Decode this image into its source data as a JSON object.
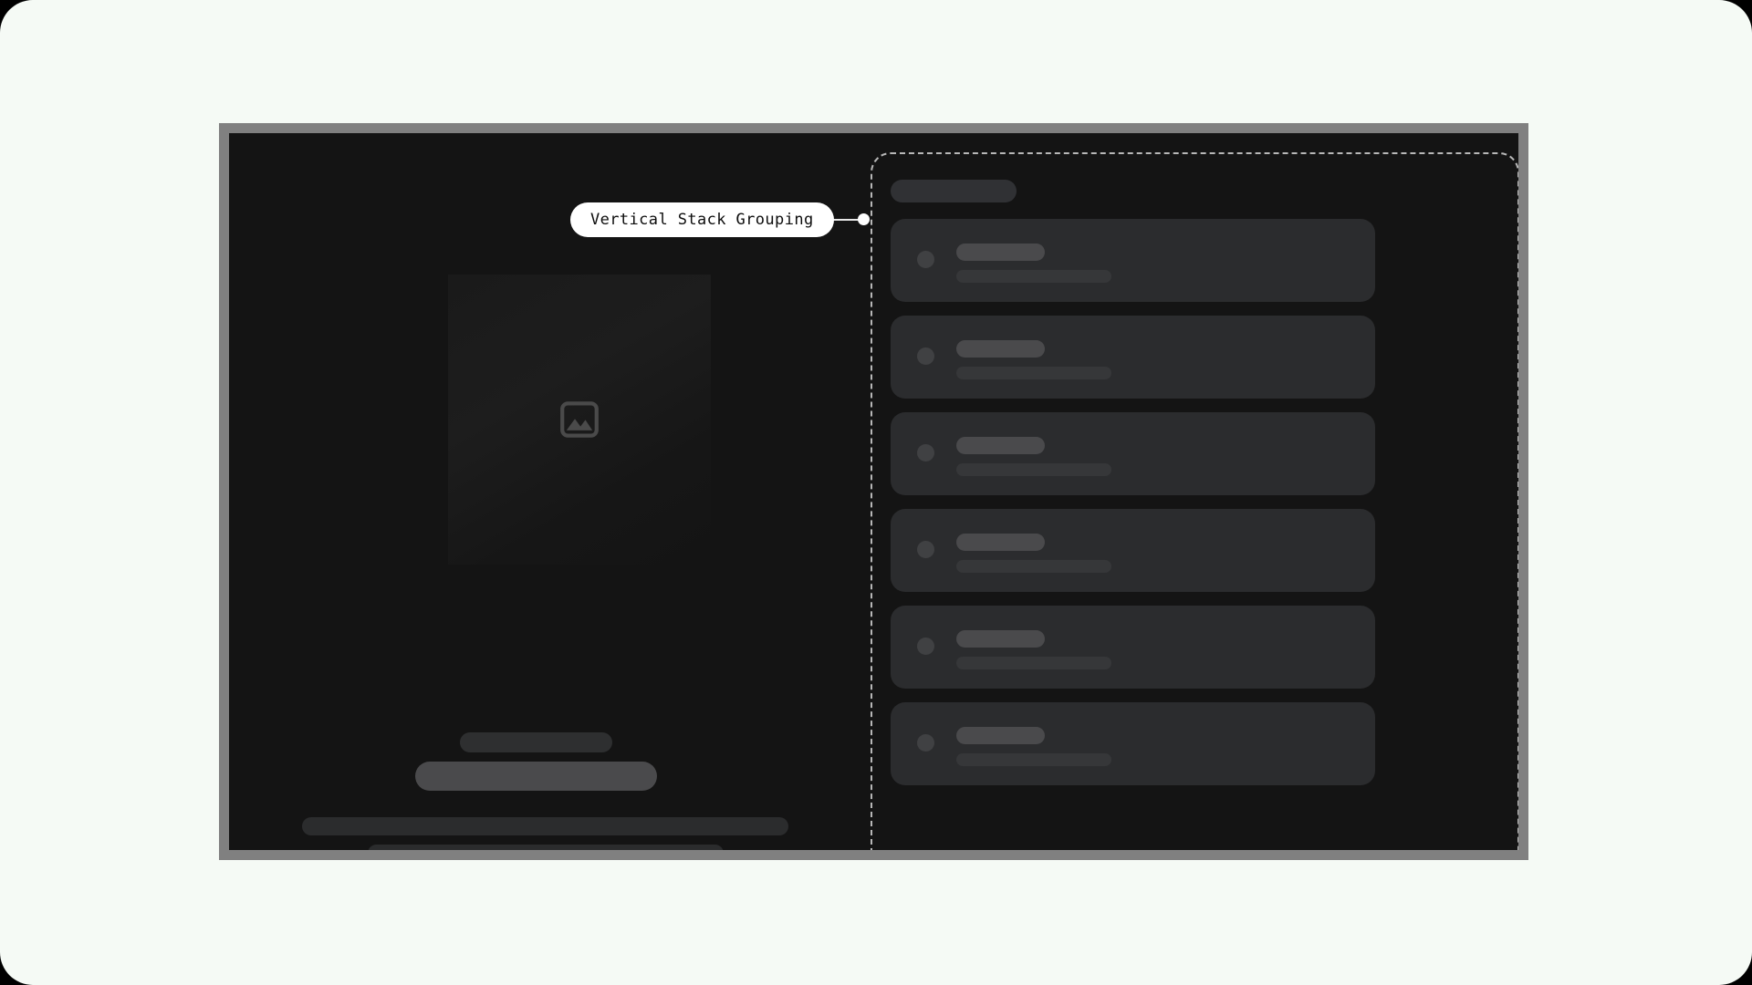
{
  "page": {
    "background_color": "#f5faf5",
    "outer_color": "#000000"
  },
  "frame": {
    "border_color": "#808080",
    "surface_color": "#141414"
  },
  "callout": {
    "label": "Vertical Stack Grouping",
    "pill_color": "#ffffff",
    "text_color": "#0d0d0d",
    "connector_color": "#e8e8e8",
    "dot_color": "#ffffff"
  },
  "group_region": {
    "border_color": "#b8b8b8",
    "border_style": "dashed"
  },
  "detail_panel": {
    "hero": {
      "icon": "image-placeholder-icon",
      "icon_color": "#4a4a4a"
    },
    "skeleton_bars": [
      {
        "name": "detail-bar-1",
        "color": "#2e2f30"
      },
      {
        "name": "detail-bar-2",
        "color": "#4a4a4c"
      },
      {
        "name": "detail-bar-3",
        "color": "#2b2c2d"
      },
      {
        "name": "detail-bar-4",
        "color": "#2b2c2d"
      }
    ]
  },
  "list_panel": {
    "header_placeholder_color": "#303134",
    "card_color": "#2b2c2e",
    "avatar_color": "#404143",
    "title_color": "#4a4a4c",
    "subtitle_color": "#363739",
    "cards": [
      {
        "index": 1,
        "avatar": "avatar-placeholder",
        "title": "",
        "subtitle": ""
      },
      {
        "index": 2,
        "avatar": "avatar-placeholder",
        "title": "",
        "subtitle": ""
      },
      {
        "index": 3,
        "avatar": "avatar-placeholder",
        "title": "",
        "subtitle": ""
      },
      {
        "index": 4,
        "avatar": "avatar-placeholder",
        "title": "",
        "subtitle": ""
      },
      {
        "index": 5,
        "avatar": "avatar-placeholder",
        "title": "",
        "subtitle": ""
      },
      {
        "index": 6,
        "avatar": "avatar-placeholder",
        "title": "",
        "subtitle": ""
      }
    ]
  },
  "flow_arrow": {
    "direction": "down",
    "color": "#72bcf5",
    "icon": "arrow-down-icon"
  }
}
